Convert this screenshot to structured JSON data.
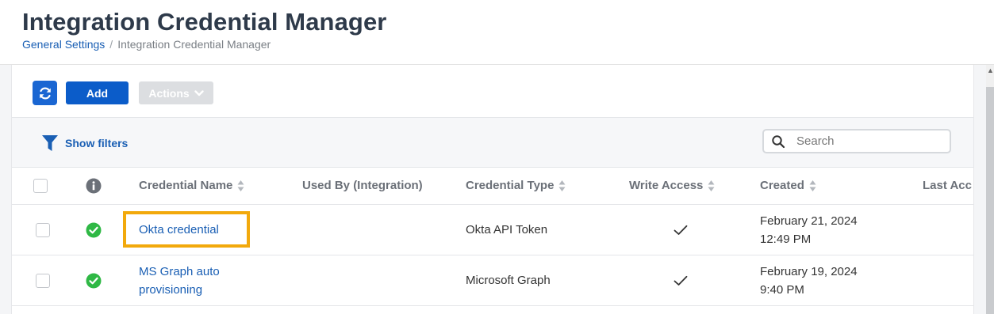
{
  "header": {
    "title": "Integration Credential Manager",
    "breadcrumb": [
      {
        "label": "General Settings"
      },
      {
        "label": "Integration Credential Manager"
      }
    ],
    "breadcrumb_separator": "/"
  },
  "toolbar": {
    "refresh_icon": "refresh-icon",
    "add_label": "Add",
    "actions_label": "Actions",
    "primary_color": "#0b5cc9"
  },
  "filters": {
    "show_filters_label": "Show filters",
    "search_placeholder": "Search"
  },
  "table": {
    "columns": [
      {
        "label": "",
        "type": "select-all"
      },
      {
        "label": "",
        "type": "info-icon"
      },
      {
        "label": "Credential Name",
        "sortable": true
      },
      {
        "label": "Used By (Integration)",
        "sortable": false
      },
      {
        "label": "Credential Type",
        "sortable": true
      },
      {
        "label": "Write Access",
        "sortable": true
      },
      {
        "label": "Created",
        "sortable": true
      },
      {
        "label": "Last Acc",
        "sortable": false
      }
    ],
    "rows": [
      {
        "status": "success-check",
        "name_line1": "Okta credential",
        "name_line2": "",
        "used_by": "",
        "type": "Okta API Token",
        "write_access": true,
        "created_date": "February 21, 2024",
        "created_time": "12:49 PM",
        "highlighted": true
      },
      {
        "status": "success-check",
        "name_line1": "MS Graph auto",
        "name_line2": "provisioning",
        "used_by": "",
        "type": "Microsoft Graph",
        "write_access": true,
        "created_date": "February 19, 2024",
        "created_time": "9:40 PM",
        "highlighted": false
      }
    ]
  },
  "colors": {
    "status_green": "#2fb845",
    "link_blue": "#1a5fb4",
    "highlight_orange": "#f2a90c"
  }
}
